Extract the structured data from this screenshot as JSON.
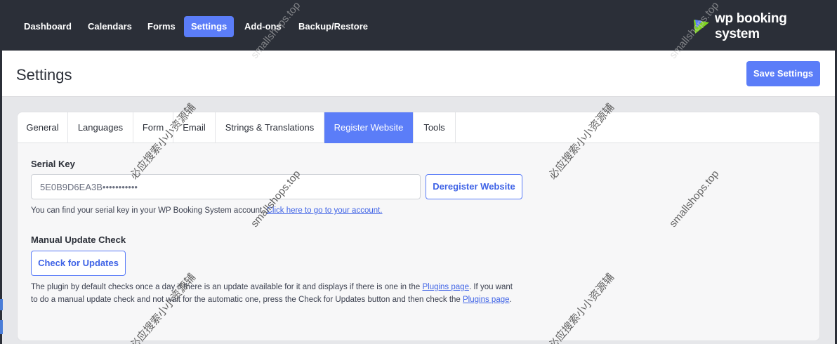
{
  "nav": {
    "items": [
      {
        "label": "Dashboard",
        "active": false
      },
      {
        "label": "Calendars",
        "active": false
      },
      {
        "label": "Forms",
        "active": false
      },
      {
        "label": "Settings",
        "active": true
      },
      {
        "label": "Add-ons",
        "active": false
      },
      {
        "label": "Backup/Restore",
        "active": false
      }
    ],
    "brand": "wp booking system"
  },
  "header": {
    "title": "Settings",
    "save_label": "Save Settings"
  },
  "tabs": [
    {
      "label": "General",
      "active": false
    },
    {
      "label": "Languages",
      "active": false
    },
    {
      "label": "Form",
      "active": false
    },
    {
      "label": "Email",
      "active": false
    },
    {
      "label": "Strings & Translations",
      "active": false
    },
    {
      "label": "Register Website",
      "active": true
    },
    {
      "label": "Tools",
      "active": false
    }
  ],
  "serial": {
    "label": "Serial Key",
    "value": "5E0B9D6EA3B•••••••••••",
    "deregister_label": "Deregister Website",
    "help_text": "You can find your serial key in your WP Booking System account.",
    "help_link": "Click here to go to your account."
  },
  "update": {
    "label": "Manual Update Check",
    "button_label": "Check for Updates",
    "help_part1": "The plugin by default checks once a day if there is an update available for it and displays if there is one in the",
    "help_link1": "Plugins page",
    "help_part2": ". If you want to do a manual update check and not wait for the automatic one, press the Check for Updates button and then check the",
    "help_link2": "Plugins page",
    "help_part3": "."
  },
  "watermarks": {
    "cn": "必应搜索小小资源辅",
    "site": "smallshops.top"
  },
  "colors": {
    "accent": "#5b7df8",
    "topbar": "#2b2f38"
  }
}
